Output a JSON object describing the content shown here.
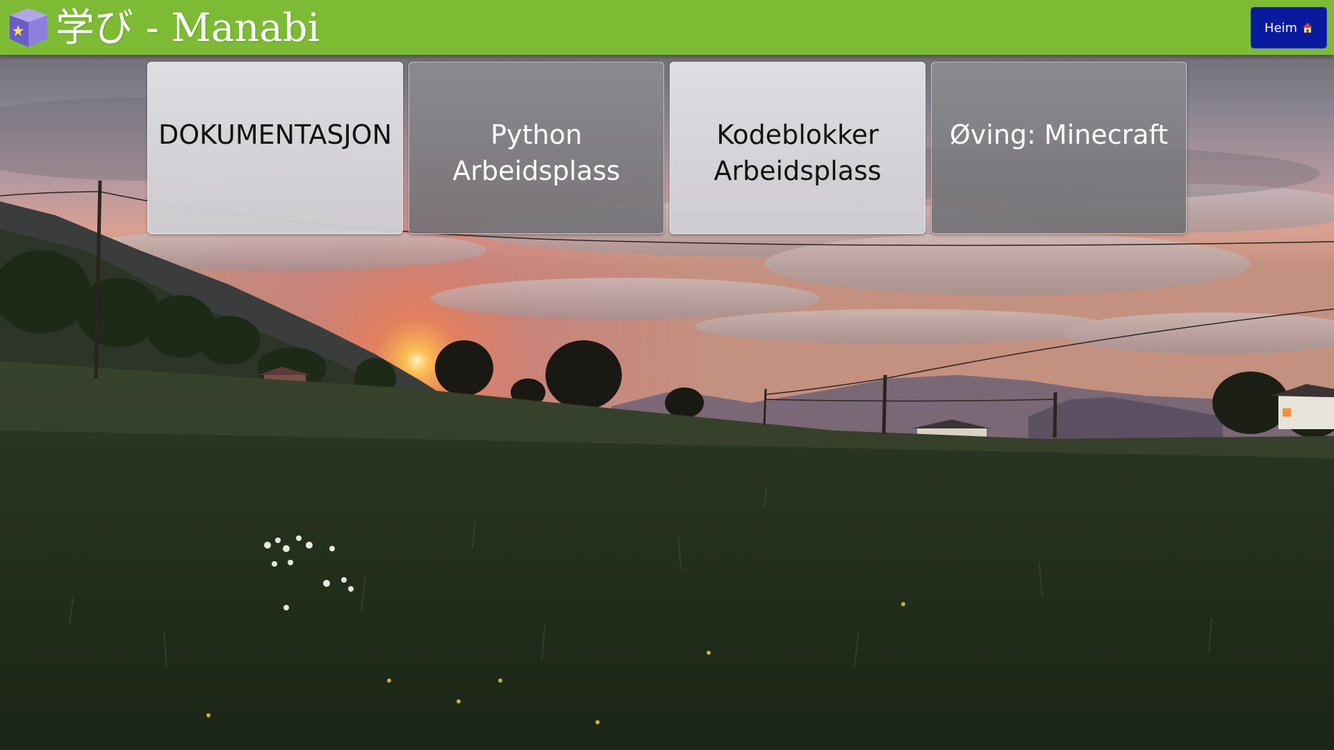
{
  "header": {
    "title": "学び - Manabi",
    "logo_icon": "cube-logo-icon",
    "background_color": "#7dbb35",
    "home_button": {
      "label": "Heim",
      "icon": "house-icon",
      "color": "#0a1a9e"
    }
  },
  "tiles": [
    {
      "label": "DOKUMENTASJON",
      "style": "light"
    },
    {
      "label": "Python Arbeidsplass",
      "style": "dark"
    },
    {
      "label": "Kodeblokker Arbeidsplass",
      "style": "light"
    },
    {
      "label": "Øving: Minecraft",
      "style": "dark"
    }
  ]
}
